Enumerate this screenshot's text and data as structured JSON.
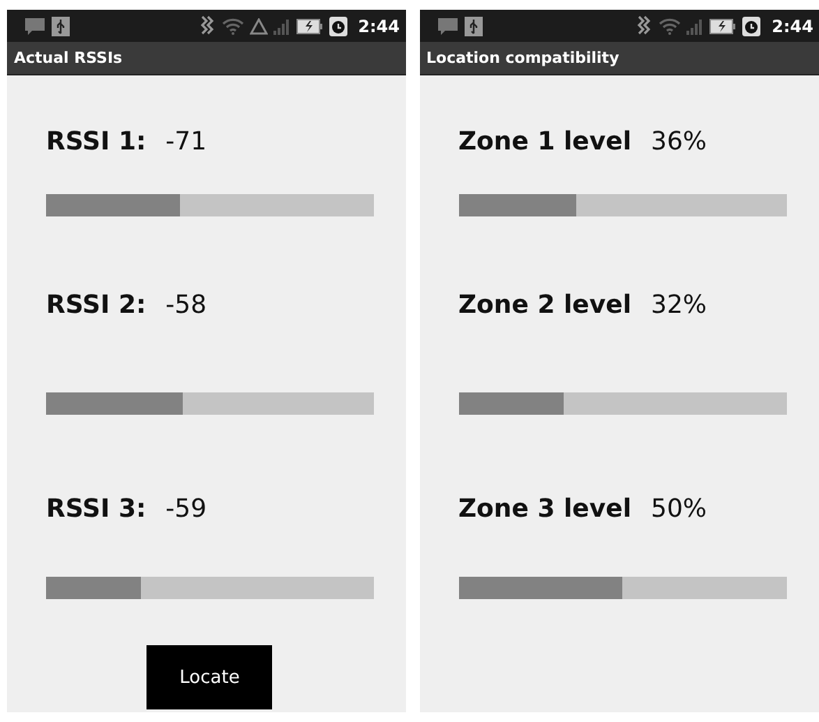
{
  "screens": [
    {
      "status_bar": {
        "time": "2:44",
        "data_warning": true
      },
      "title": "Actual RSSIs",
      "rows": [
        {
          "label": "RSSI 1:",
          "value": "-71",
          "level": 0.41
        },
        {
          "label": "RSSI 2:",
          "value": "-58",
          "level": 0.42
        },
        {
          "label": "RSSI 3:",
          "value": "-59",
          "level": 0.29
        }
      ],
      "button": "Locate"
    },
    {
      "status_bar": {
        "time": "2:44",
        "data_warning": false
      },
      "title": "Location compatibility",
      "rows": [
        {
          "label": "Zone 1 level",
          "value": "36%",
          "level": 0.36
        },
        {
          "label": "Zone 2 level",
          "value": "32%",
          "level": 0.32
        },
        {
          "label": "Zone 3 level",
          "value": "50%",
          "level": 0.5
        }
      ]
    }
  ]
}
